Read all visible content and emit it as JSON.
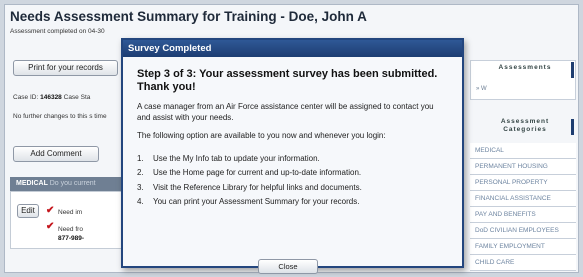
{
  "background": {
    "title": "Needs Assessment Summary for Training - Doe, John A",
    "subtitle": "Assessment completed on 04-30",
    "print_button": "Print for your records",
    "case_label": "Case ID:",
    "case_id": "146328",
    "case_status_label": "Case Sta",
    "no_changes_text": "No further changes to this s time",
    "add_comment_button": "Add Comment",
    "medical_label": "MEDICAL",
    "medical_suffix": "Do you current",
    "edit_button": "Edit",
    "needs": [
      {
        "text": "Need im"
      },
      {
        "text": "Need fro",
        "phone": "877-989-"
      }
    ],
    "sidebar": {
      "assessments_heading": "Assessments",
      "assessments_sub": "» W",
      "categories_heading": "Assessment Categories",
      "categories": [
        "MEDICAL",
        "PERMANENT HOUSING",
        "PERSONAL PROPERTY",
        "FINANCIAL ASSISTANCE",
        "PAY AND BENEFITS",
        "DoD CIVILIAN EMPLOYEES",
        "FAMILY EMPLOYMENT",
        "CHILD CARE"
      ]
    }
  },
  "dialog": {
    "bar_title": "Survey Completed",
    "heading": "Step 3 of 3: Your assessment survey has been submitted. Thank you!",
    "paragraph1": "A case manager from an Air Force assistance center will be assigned to contact you and assist with your needs.",
    "paragraph2": "The following option are available to you now and whenever you login:",
    "options": [
      {
        "num": "1.",
        "text": "Use the My Info tab to update your information."
      },
      {
        "num": "2.",
        "text": "Use the Home page for current and up-to-date information."
      },
      {
        "num": "3.",
        "text": "Visit the Reference Library for helpful links and documents."
      },
      {
        "num": "4.",
        "text": "You can print your Assessment Summary for your records."
      }
    ],
    "close_button": "Close"
  },
  "colors": {
    "dialog_bar": "#1d3d72",
    "check": "#c4151c",
    "category_text": "#6d84a0"
  }
}
